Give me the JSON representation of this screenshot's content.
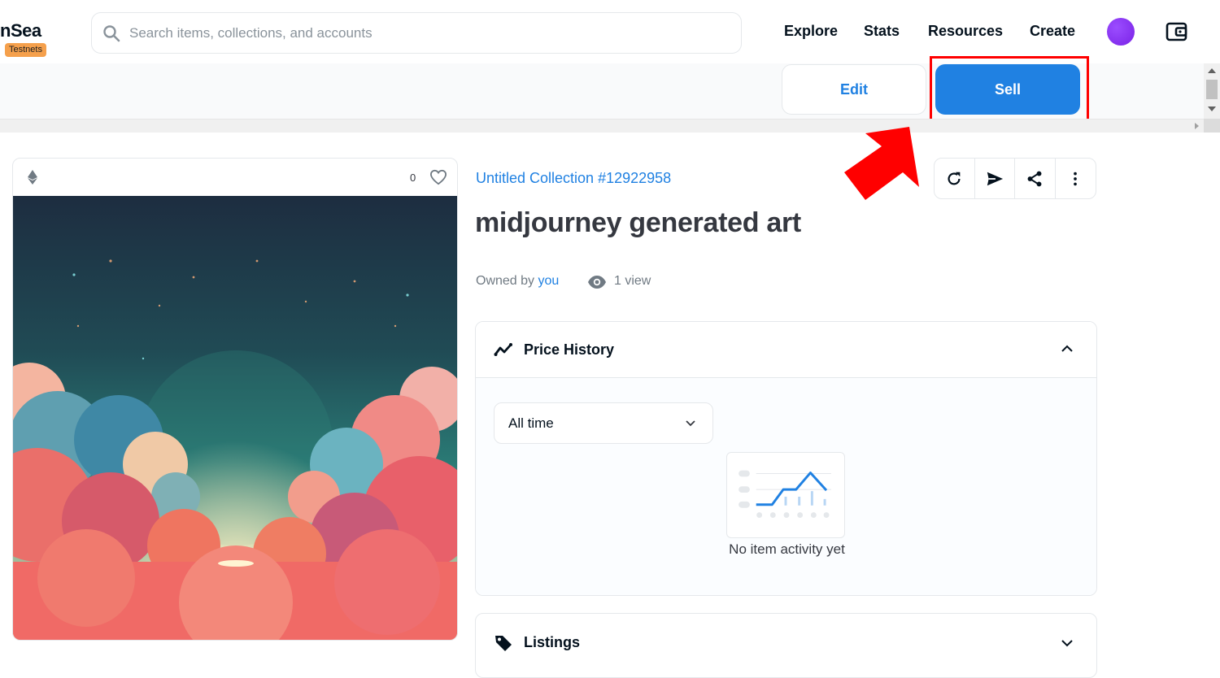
{
  "header": {
    "logo_text": "nSea",
    "badge": "Testnets",
    "search_placeholder": "Search items, collections, and accounts",
    "nav": [
      "Explore",
      "Stats",
      "Resources",
      "Create"
    ],
    "icons": [
      "search-icon",
      "avatar",
      "wallet-icon"
    ]
  },
  "action_bar": {
    "edit_label": "Edit",
    "sell_label": "Sell",
    "accent": "#2081e2",
    "highlight_color": "#ff0000"
  },
  "item": {
    "favorites": "0",
    "collection": "Untitled Collection #12922958",
    "title": "midjourney generated art",
    "owned_prefix": "Owned by",
    "owner": "you",
    "views": "1 view"
  },
  "toolbar_icons": [
    "refresh-icon",
    "transfer-icon",
    "share-icon",
    "more-icon"
  ],
  "price_history": {
    "title": "Price History",
    "filter_value": "All time",
    "empty_text": "No item activity yet"
  },
  "listings": {
    "title": "Listings"
  }
}
